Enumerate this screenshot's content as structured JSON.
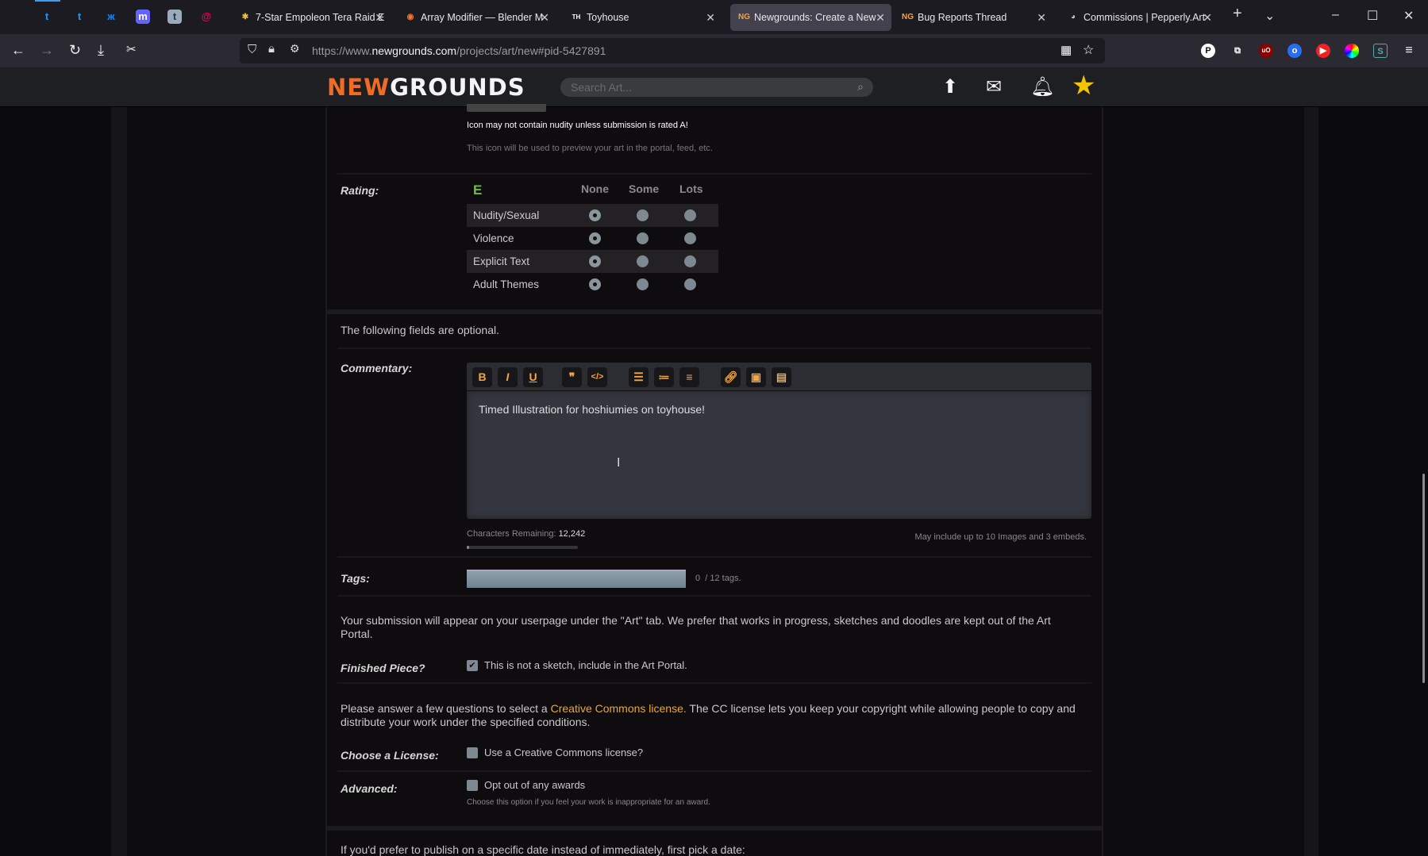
{
  "browser": {
    "pinned_tabs": [
      "twitter",
      "twitter",
      "bluesky",
      "mastodon",
      "tumblr",
      "debian"
    ],
    "tabs": [
      {
        "title": "7-Star Empoleon Tera Raid E",
        "active": false
      },
      {
        "title": "Array Modifier — Blender M",
        "active": false
      },
      {
        "title": "Toyhouse",
        "active": false
      },
      {
        "title": "Newgrounds: Create a New",
        "active": true
      },
      {
        "title": "Bug Reports Thread",
        "active": false
      },
      {
        "title": "Commissions | Pepperly.Art",
        "active": false
      }
    ],
    "url_prefix": "https://www.",
    "url_domain": "newgrounds.com",
    "url_path": "/projects/art/new#pid-5427891"
  },
  "site": {
    "logo_a": "NEW",
    "logo_b": "GROUNDS",
    "search_placeholder": "Search Art..."
  },
  "icon_section": {
    "warning": "Icon may not contain nudity unless submission is rated A!",
    "note": "This icon will be used to preview your art in the portal, feed, etc."
  },
  "rating": {
    "label": "Rating:",
    "badge": "E",
    "columns": [
      "None",
      "Some",
      "Lots"
    ],
    "rows": [
      {
        "name": "Nudity/Sexual",
        "selected": "None"
      },
      {
        "name": "Violence",
        "selected": "None"
      },
      {
        "name": "Explicit Text",
        "selected": "None"
      },
      {
        "name": "Adult Themes",
        "selected": "None"
      }
    ]
  },
  "optional_note": "The following fields are optional.",
  "commentary": {
    "label": "Commentary:",
    "text": "Timed Illustration for hoshiumies on toyhouse!",
    "chars_label": "Characters Remaining:",
    "chars_value": "12,242",
    "limit_note": "May include up to 10 Images and 3 embeds.",
    "progress": 0.02
  },
  "tags": {
    "label": "Tags:",
    "count": "0",
    "max": "/ 12 tags."
  },
  "portal_note": "Your submission will appear on your userpage under the \"Art\" tab. We prefer that works in progress, sketches and doodles are kept out of the Art Portal.",
  "finished": {
    "label": "Finished Piece?",
    "text": "This is not a sketch, include in the Art Portal.",
    "checked": true
  },
  "cc": {
    "pre": "Please answer a few questions to select a ",
    "link": "Creative Commons license.",
    "post": " The CC license lets you keep your copyright while allowing people to copy and distribute your work under the specified conditions."
  },
  "license": {
    "label": "Choose a License:",
    "text": "Use a Creative Commons license?",
    "checked": false
  },
  "advanced": {
    "label": "Advanced:",
    "text": "Opt out of any awards",
    "note": "Choose this option if you feel your work is inappropriate for an award.",
    "checked": false
  },
  "schedule_note": "If you'd prefer to publish on a specific date instead of immediately, first pick a date:"
}
